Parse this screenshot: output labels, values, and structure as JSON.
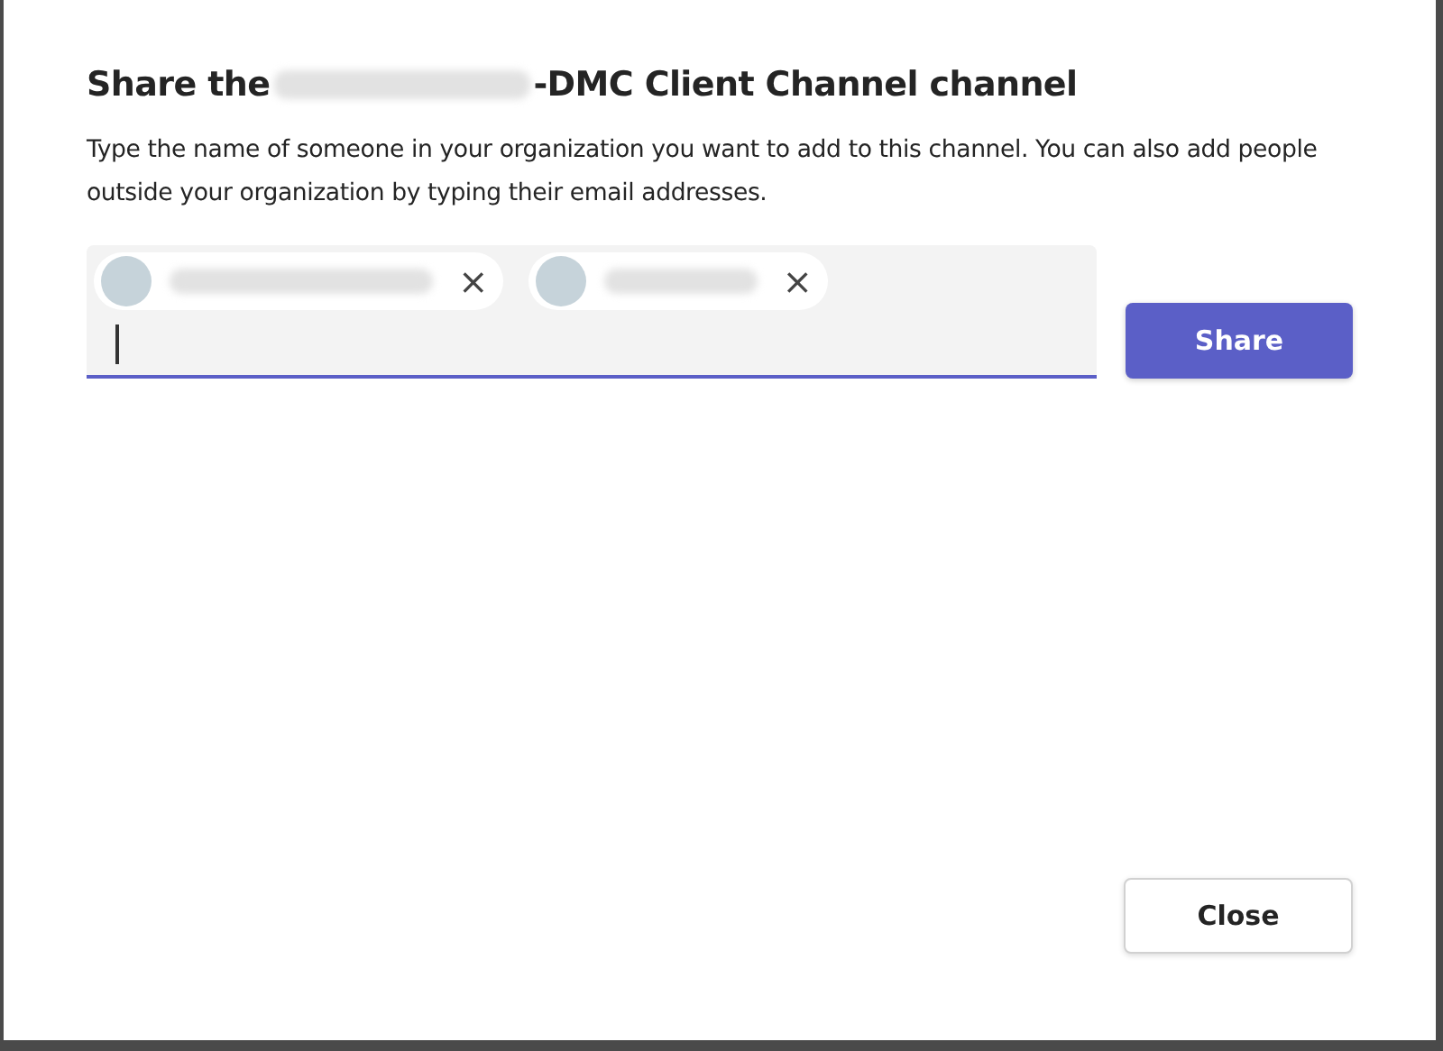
{
  "dialog": {
    "title_start": "Share the",
    "title_end": "-DMC Client Channel channel",
    "description": "Type the name of someone in your organization you want to add to this channel. You can also add people outside your organization by typing their email addresses.",
    "recipients": [
      {
        "remove": "×"
      },
      {
        "remove": "×"
      }
    ],
    "share_button": "Share",
    "close_button": "Close"
  }
}
